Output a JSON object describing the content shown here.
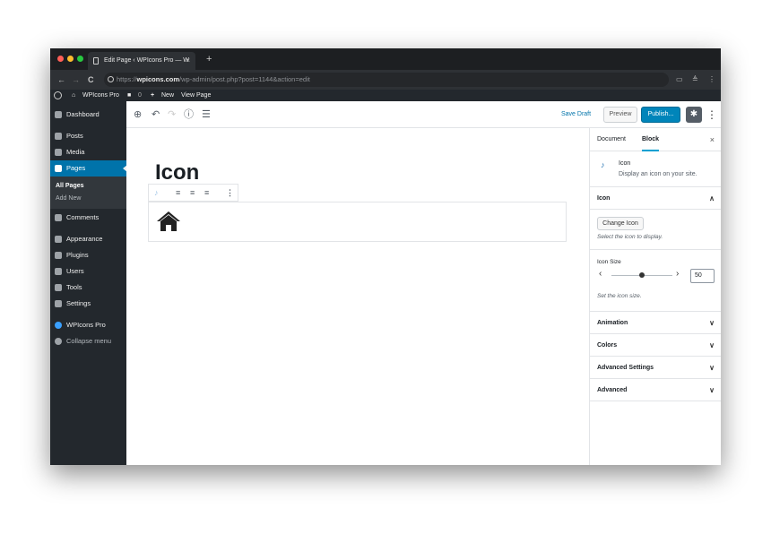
{
  "browser": {
    "tab_title": "Edit Page ‹ WPIcons Pro — W",
    "tab_close": "×",
    "new_tab": "+",
    "url_scheme": "https://",
    "url_domain": "wpicons.com",
    "url_path": "/wp-admin/post.php?post=1144&action=edit",
    "nav_back": "←",
    "nav_forward": "→",
    "nav_reload": "C"
  },
  "adminbar": {
    "site_name": "WPIcons Pro",
    "comments_count": "0",
    "new_label": "New",
    "view_page": "View Page"
  },
  "sidebar": {
    "items": [
      {
        "label": "Dashboard"
      },
      {
        "label": "Posts"
      },
      {
        "label": "Media"
      },
      {
        "label": "Pages"
      },
      {
        "label": "Comments"
      },
      {
        "label": "Appearance"
      },
      {
        "label": "Plugins"
      },
      {
        "label": "Users"
      },
      {
        "label": "Tools"
      },
      {
        "label": "Settings"
      },
      {
        "label": "WPIcons Pro"
      },
      {
        "label": "Collapse menu"
      }
    ],
    "submenu": {
      "all_pages": "All Pages",
      "add_new": "Add New"
    }
  },
  "toolbar": {
    "save_draft": "Save Draft",
    "preview": "Preview",
    "publish": "Publish..."
  },
  "editor": {
    "page_title": "Icon"
  },
  "settings": {
    "tab_document": "Document",
    "tab_block": "Block",
    "close": "×",
    "block_name": "Icon",
    "block_desc": "Display an icon on your site.",
    "icon_panel": "Icon",
    "change_icon": "Change Icon",
    "change_icon_help": "Select the icon to display.",
    "icon_size_label": "Icon Size",
    "icon_size_value": "50",
    "icon_size_help": "Set the icon size.",
    "panels": [
      "Animation",
      "Colors",
      "Advanced Settings",
      "Advanced"
    ]
  },
  "colors": {
    "wp_dark": "#23282d",
    "wp_blue": "#0073aa",
    "publish_blue": "#0085ba",
    "traffic_red": "#ff5f57",
    "traffic_yellow": "#febc2e",
    "traffic_green": "#28c840"
  }
}
